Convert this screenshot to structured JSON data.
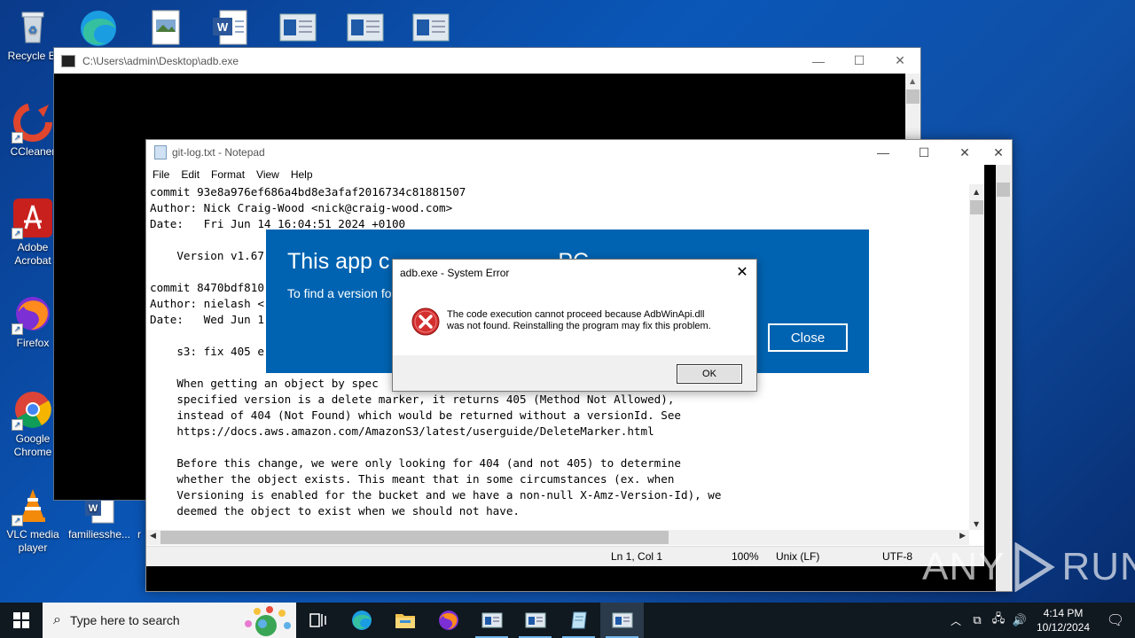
{
  "desktop": {
    "icons": [
      {
        "label": "Recycle Bin",
        "visible_label": "Recycle Bi"
      },
      {
        "label": "CCleaner"
      },
      {
        "label": "Adobe Acrobat",
        "visible_label": "Adobe\nAcrobat"
      },
      {
        "label": "Firefox"
      },
      {
        "label": "Google Chrome",
        "visible_label": "Google\nChrome"
      },
      {
        "label": "VLC media player",
        "visible_label": "VLC media\nplayer"
      },
      {
        "label": "familiesshe...",
        "visible_label": "familiesshe..."
      },
      {
        "label": "r"
      }
    ]
  },
  "adb_window": {
    "title": "C:\\Users\\admin\\Desktop\\adb.exe",
    "minimize": "—",
    "maximize": "☐",
    "close": "✕"
  },
  "notepad": {
    "title": "git-log.txt - Notepad",
    "menu": [
      "File",
      "Edit",
      "Format",
      "View",
      "Help"
    ],
    "lines": [
      "commit 93e8a976ef686a4bd8e3afaf2016734c81881507",
      "Author: Nick Craig-Wood <nick@craig-wood.com>",
      "Date:   Fri Jun 14 16:04:51 2024 +0100",
      "",
      "    Version v1.67",
      "",
      "commit 8470bdf810",
      "Author: nielash <",
      "Date:   Wed Jun 1",
      "",
      "    s3: fix 405 e",
      "",
      "    When getting an object by spec",
      "    specified version is a delete marker, it returns 405 (Method Not Allowed),",
      "    instead of 404 (Not Found) which would be returned without a versionId. See",
      "    https://docs.aws.amazon.com/AmazonS3/latest/userguide/DeleteMarker.html",
      "",
      "    Before this change, we were only looking for 404 (and not 405) to determine",
      "    whether the object exists. This meant that in some circumstances (ex. when",
      "    Versioning is enabled for the bucket and we have a non-null X-Amz-Version-Id), we",
      "    deemed the object to exist when we should not have."
    ],
    "status": {
      "position": "Ln 1, Col 1",
      "zoom": "100%",
      "line_ending": "Unix (LF)",
      "encoding": "UTF-8"
    }
  },
  "blue_dialog": {
    "heading": "This app c",
    "heading_tail": "PC",
    "subtext": "To find a version fo",
    "close_label": "Close"
  },
  "error_dialog": {
    "title": "adb.exe - System Error",
    "message_line1": "The code execution cannot proceed because AdbWinApi.dll",
    "message_line2": "was not found. Reinstalling the program may fix this problem.",
    "ok_label": "OK"
  },
  "watermark": {
    "text_left": "ANY",
    "text_right": "RUN"
  },
  "taskbar": {
    "search_placeholder": "Type here to search",
    "clock_time": "4:14 PM",
    "clock_date": "10/12/2024"
  },
  "colors": {
    "dialog_blue": "#0063b1",
    "error_red": "#d32f2f",
    "taskbar": "#101820"
  }
}
